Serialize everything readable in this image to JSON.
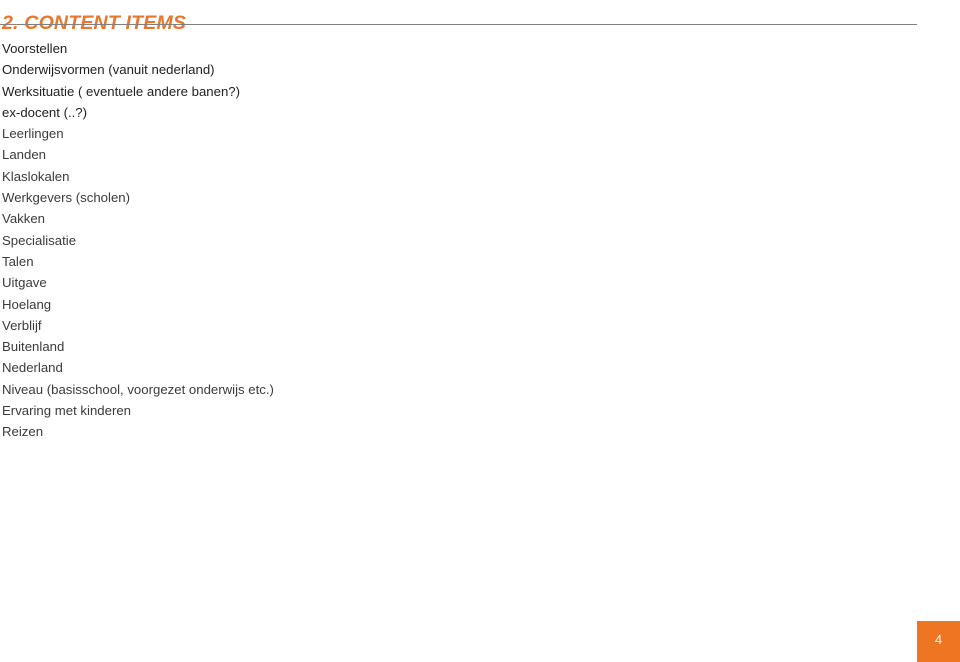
{
  "slide": {
    "heading": "2. CONTENT ITEMS",
    "heading_color": "#E8762C",
    "background_color": "#FFFFFF",
    "divider_color": "#808080",
    "items": [
      {
        "label": "Voorstellen",
        "emphasis": true
      },
      {
        "label": "Onderwijsvormen (vanuit nederland)",
        "emphasis": true
      },
      {
        "label": "Werksituatie ( eventuele andere banen?)",
        "emphasis": true
      },
      {
        "label": "ex-docent (..?)",
        "emphasis": true
      },
      {
        "label": "Leerlingen",
        "emphasis": false
      },
      {
        "label": "Landen",
        "emphasis": false
      },
      {
        "label": "Klaslokalen",
        "emphasis": false
      },
      {
        "label": "Werkgevers (scholen)",
        "emphasis": false
      },
      {
        "label": "Vakken",
        "emphasis": false
      },
      {
        "label": "Specialisatie",
        "emphasis": false
      },
      {
        "label": "Talen",
        "emphasis": false
      },
      {
        "label": "Uitgave",
        "emphasis": false
      },
      {
        "label": "Hoelang",
        "emphasis": false
      },
      {
        "label": "Verblijf",
        "emphasis": false
      },
      {
        "label": "Buitenland",
        "emphasis": false
      },
      {
        "label": "Nederland",
        "emphasis": false
      },
      {
        "label": "Niveau (basisschool, voorgezet onderwijs etc.)",
        "emphasis": false
      },
      {
        "label": "Ervaring met kinderen",
        "emphasis": false
      },
      {
        "label": "Reizen",
        "emphasis": false
      }
    ]
  },
  "footer": {
    "page_number": "4",
    "badge_color": "#EE7623",
    "page_number_color": "#FFFFFF"
  }
}
